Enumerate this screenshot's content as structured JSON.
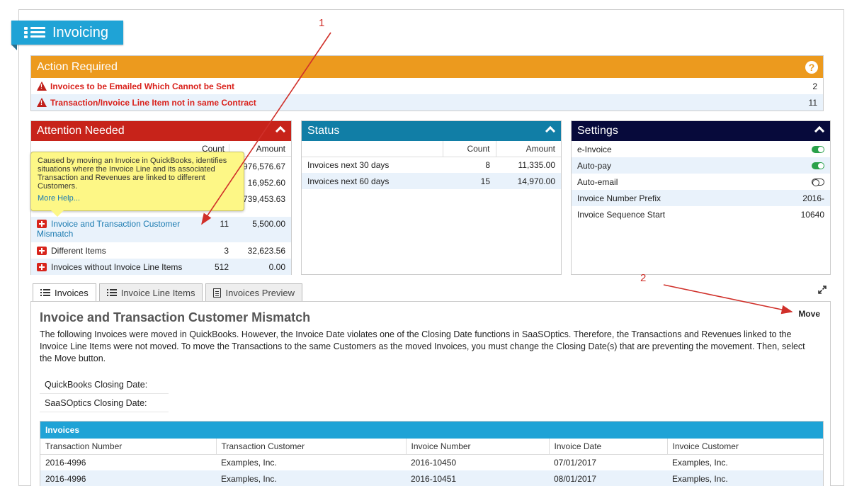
{
  "header": {
    "title": "Invoicing",
    "icon": "menu-list-icon"
  },
  "action_required": {
    "title": "Action Required",
    "rows": [
      {
        "label": "Invoices to be Emailed Which Cannot be Sent",
        "count": "2"
      },
      {
        "label": "Transaction/Invoice Line Item not in same Contract",
        "count": "11"
      }
    ]
  },
  "attention": {
    "title": "Attention Needed",
    "columns": {
      "count": "Count",
      "amount": "Amount"
    },
    "hidden_amounts": [
      "976,576.67",
      "16,952.60",
      "739,453.63"
    ],
    "rows": [
      {
        "label": "Invoice and Transaction Customer Mismatch",
        "count": "11",
        "amount": "5,500.00",
        "link": true
      },
      {
        "label": "Different Items",
        "count": "3",
        "amount": "32,623.56",
        "link": false
      },
      {
        "label": "Invoices without Invoice Line Items",
        "count": "512",
        "amount": "0.00",
        "link": false
      }
    ],
    "tooltip": {
      "text": "Caused by moving an Invoice in QuickBooks, identifies situations where the Invoice Line and its associated Transaction and Revenues are linked to different Customers.",
      "more": "More Help..."
    }
  },
  "status": {
    "title": "Status",
    "columns": {
      "count": "Count",
      "amount": "Amount"
    },
    "rows": [
      {
        "label": "Invoices next 30 days",
        "count": "8",
        "amount": "11,335.00"
      },
      {
        "label": "Invoices next 60 days",
        "count": "15",
        "amount": "14,970.00"
      }
    ]
  },
  "settings": {
    "title": "Settings",
    "rows": [
      {
        "label": "e-Invoice",
        "toggle": "on"
      },
      {
        "label": "Auto-pay",
        "toggle": "on"
      },
      {
        "label": "Auto-email",
        "toggle": "off"
      },
      {
        "label": "Invoice Number Prefix",
        "value": "2016-"
      },
      {
        "label": "Invoice Sequence Start",
        "value": "10640"
      }
    ]
  },
  "tabs": [
    {
      "label": "Invoices",
      "active": true
    },
    {
      "label": "Invoice Line Items",
      "active": false
    },
    {
      "label": "Invoices Preview",
      "active": false
    }
  ],
  "content": {
    "heading": "Invoice and Transaction Customer Mismatch",
    "description": "The following Invoices were moved in QuickBooks. However, the Invoice Date violates one of the Closing Date functions in SaaSOptics. Therefore, the Transactions and Revenues linked to the Invoice Line Items were not moved. To move the Transactions to the same Customers as the moved Invoices, you must change the Closing Date(s) that are preventing the movement. Then, select the Move button.",
    "quickbooks_closing_label": "QuickBooks Closing Date:",
    "saasoptics_closing_label": "SaaSOptics Closing Date:",
    "move_label": "Move"
  },
  "invoices_table": {
    "title": "Invoices",
    "columns": [
      "Transaction Number",
      "Transaction Customer",
      "Invoice Number",
      "Invoice Date",
      "Invoice Customer"
    ],
    "rows": [
      [
        "2016-4996",
        "Examples, Inc.",
        "2016-10450",
        "07/01/2017",
        "Examples, Inc."
      ],
      [
        "2016-4996",
        "Examples, Inc.",
        "2016-10451",
        "08/01/2017",
        "Examples, Inc."
      ]
    ]
  },
  "annotations": {
    "one": "1",
    "two": "2"
  },
  "colors": {
    "accent_blue": "#1fa3d6",
    "action_orange": "#ec9a1e",
    "attention_red": "#c7231a",
    "status_teal": "#117ea6",
    "settings_navy": "#070a3b",
    "annotation_red": "#d0302a"
  }
}
